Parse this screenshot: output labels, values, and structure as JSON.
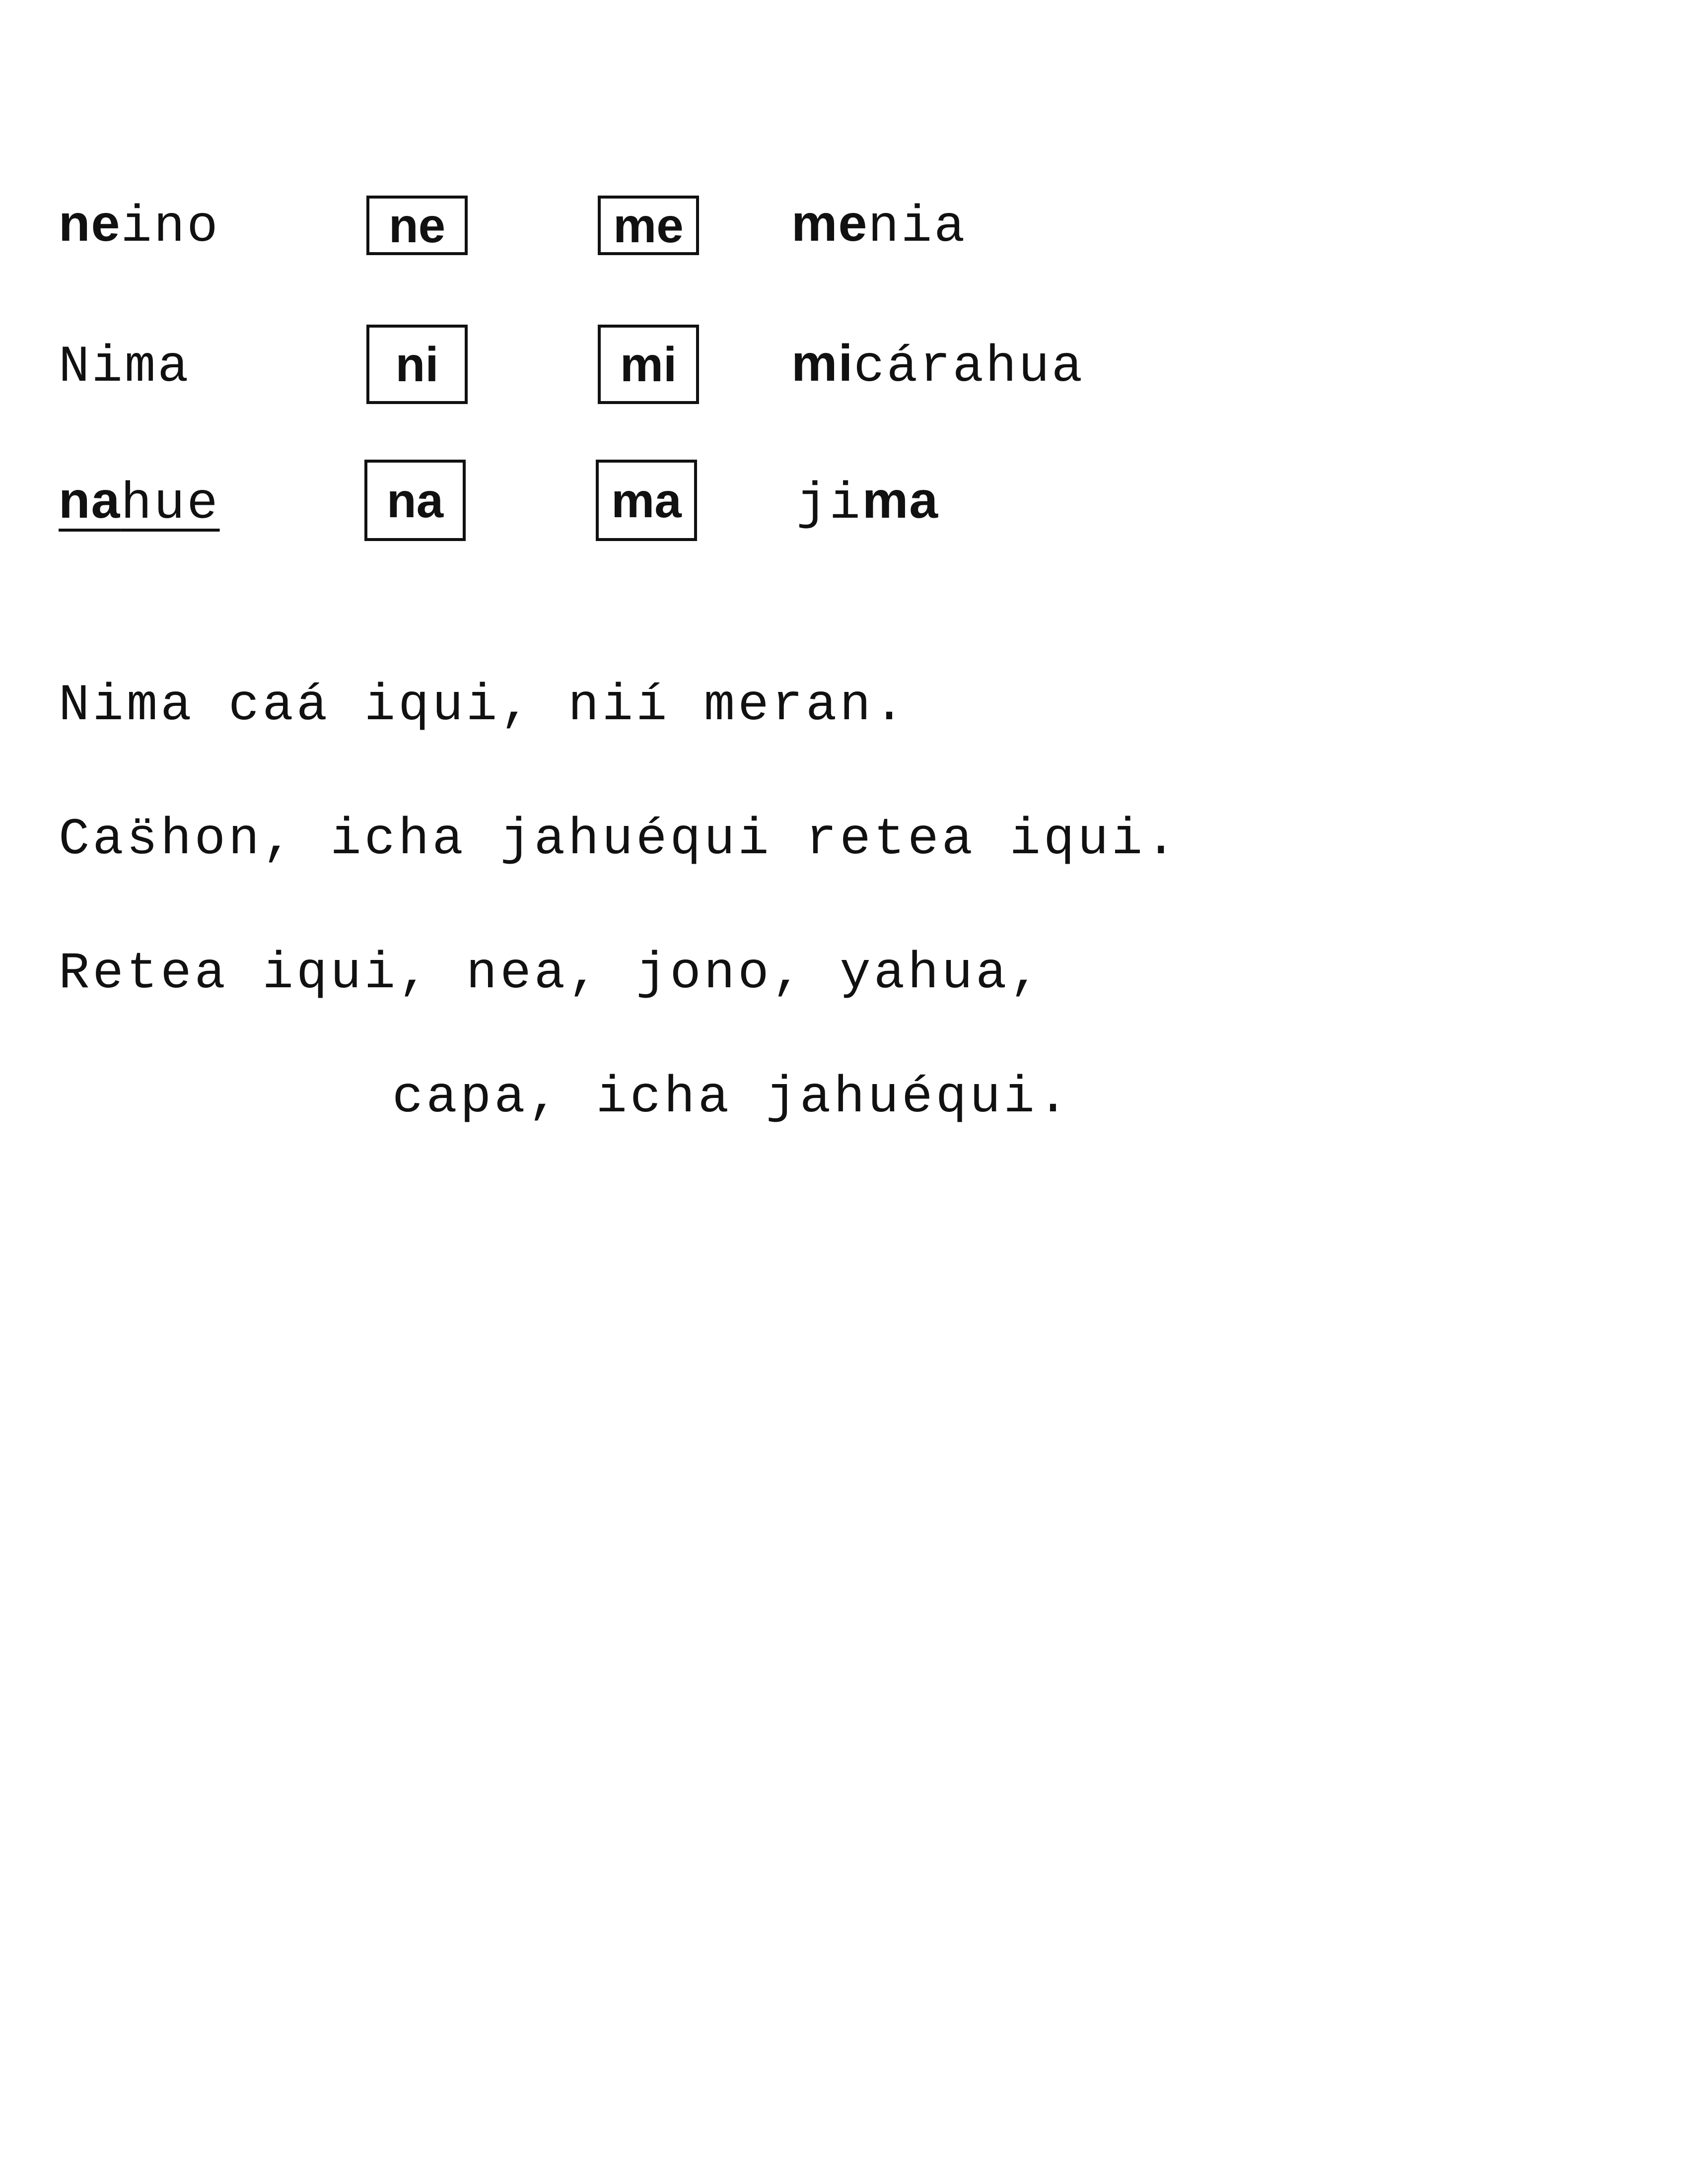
{
  "syllable_rows": [
    {
      "left_word": {
        "bold": "ne",
        "rest": "ino"
      },
      "box_n": "ne",
      "box_m": "me",
      "right_word": {
        "bold": "me",
        "rest": "nia"
      }
    },
    {
      "left_word": {
        "bold": "",
        "rest": "Nima"
      },
      "box_n": "ni",
      "box_m": "mi",
      "right_word": {
        "bold": "mi",
        "rest": "cárahua"
      }
    },
    {
      "left_word": {
        "bold": "na",
        "rest": "hue"
      },
      "box_n": "na",
      "box_m": "ma",
      "right_word": {
        "plain": "ji",
        "bold": "ma"
      }
    }
  ],
  "sentences": [
    "Nima caá iqui, nií meran.",
    "Cas̈hon, icha jahuéqui retea iqui.",
    "Retea iqui, nea, jono, yahua,",
    "capa, icha jahuéqui."
  ]
}
